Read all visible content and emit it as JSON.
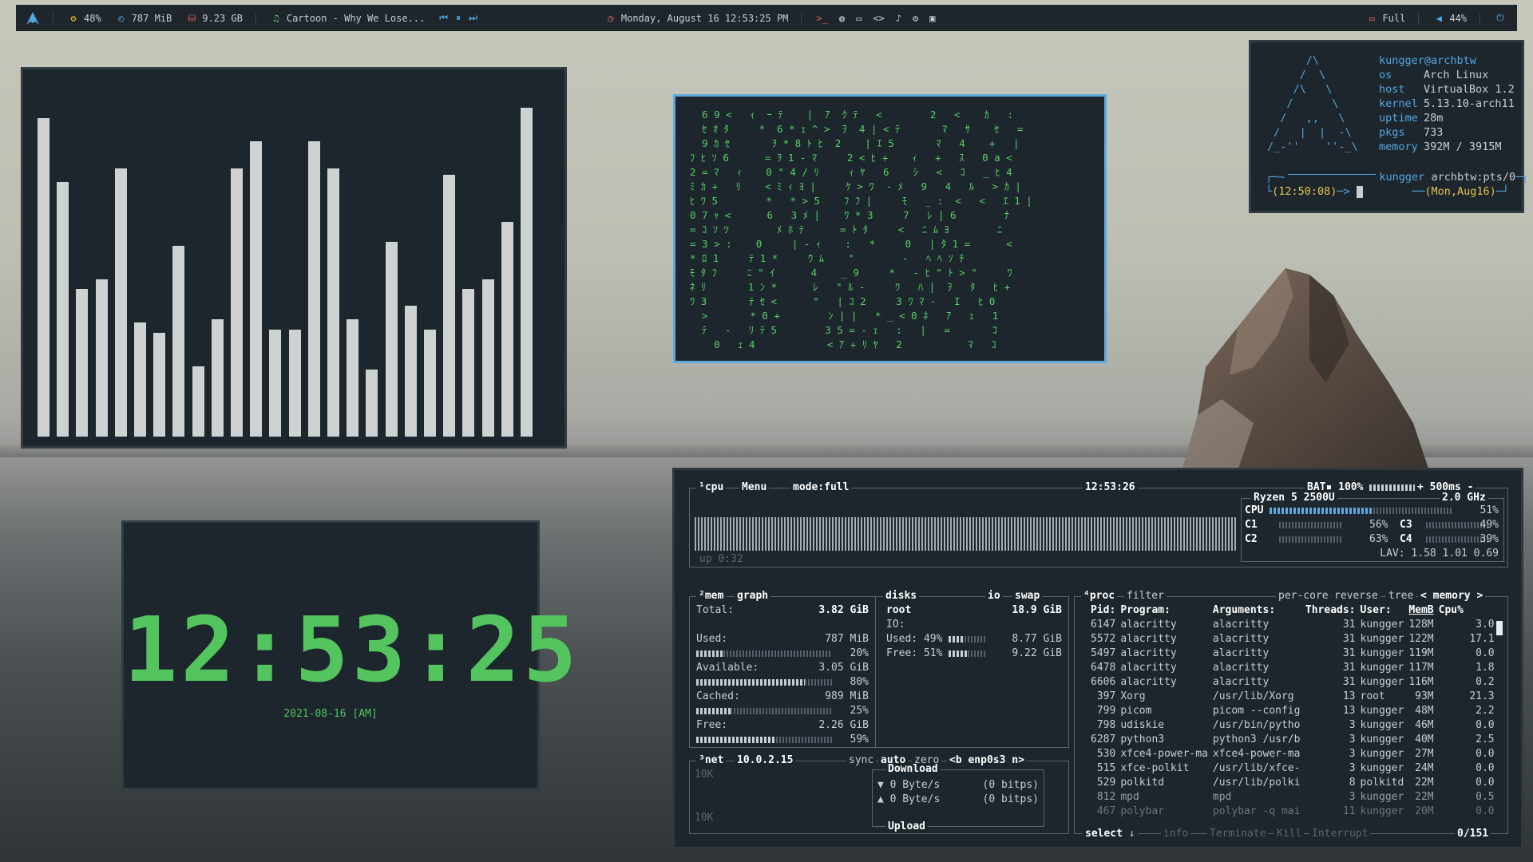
{
  "topbar": {
    "cpu": "48%",
    "ram": "787 MiB",
    "disk": "9.23 GB",
    "music": "Cartoon - Why We Lose...",
    "datetime": "Monday, August 16 12:53:25 PM",
    "battery": "Full",
    "volume": "44%"
  },
  "visualizer": {
    "levels": [
      0.95,
      0.76,
      0.44,
      0.47,
      0.8,
      0.34,
      0.31,
      0.57,
      0.21,
      0.35,
      0.8,
      0.88,
      0.32,
      0.32,
      0.88,
      0.8,
      0.35,
      0.2,
      0.58,
      0.39,
      0.32,
      0.78,
      0.44,
      0.47,
      0.64,
      0.98
    ]
  },
  "matrix": {
    "lines": [
      "  6 9 <   ｨ  ｰ ﾃ    |  ｱ  ｸ ﾃ   <        2   <    ｶ   :",
      "  ｾ ｵ ﾀ     *  6 * ｪ ^ >  ｦ  4 | < ﾃ       ﾏ   ｻ    ｾ   =",
      "  9 ｶ ｾ       ｦ * 8 ﾄ ﾋ  2    | ｴ 5       ﾏ   4    +   |",
      "ﾌ ﾋ ｿ 6      = ｦ 1 - ﾏ     2 < ﾋ +    ｨ   +   ｽ   0 a <",
      "2 = ﾏ   ｨ    0 \" 4 / ﾘ     ｨ ﾔ   6    ｼ   <   ｺ   _ ﾋ 4",
      "ﾐ ｶ +   ﾘ    < ﾐ ｨ ﾖ |     ｹ > ﾜ  - ﾒ   9   4   ﾙ   > ｶ |",
      "ﾋ ﾜ 5        *   * > 5    ﾌ ﾌ |     ﾓ   _ :  <   <   ｴ 1 |",
      "0 7 ｬ <      6   3 ﾒ |    ﾜ * 3     7   ﾚ | 6        ﾅ",
      "= ｺ ｿ ﾂ        ﾒ ﾎ ﾃ      = ﾄ ﾀ     <   ﾆ ﾑ ﾖ        ﾆ",
      "= 3 > :    0     | - ｨ    :   *     0   | ﾀ 1 =      <",
      "* ﾛ 1     ﾃ 1 *     ｳ ﾑ    \"        -   ﾍ ﾍ ｿ ﾁ",
      "ﾓ ﾀ ﾌ     ﾆ \" ｲ      4    _ 9     *   - ﾋ \" ﾄ > \"     ﾜ",
      "ﾈ ﾘ       1 ﾝ *      ﾚ   \" ﾙ -     ﾜ   ﾊ |  ｦ   ﾀ   ﾋ +",
      "ﾜ 3       ﾃ ｾ <      \"   | ｺ 2     3 ﾜ ﾏ -   I   ﾋ 0",
      "  >       * 0 +        ﾝ | |   * _ < 0 ﾈ   ｱ   ｪ   1",
      "  ﾃ   -   ﾘ ﾃ 5        3 5 = - ｪ   :   |   =       ｺ",
      "    0   ｪ 4            < ｱ + ﾘ ﾔ   2           ﾏ   ｺ"
    ]
  },
  "clock": {
    "time": "12:53:25",
    "date": "2021-08-16 [AM]"
  },
  "fetch": {
    "userhost": "kungger@archbtw",
    "rows": [
      {
        "k": "os",
        "v": "Arch Linux"
      },
      {
        "k": "host",
        "v": "VirtualBox 1.2"
      },
      {
        "k": "kernel",
        "v": "5.13.10-arch11"
      },
      {
        "k": "uptime",
        "v": "28m"
      },
      {
        "k": "pkgs",
        "v": "733"
      },
      {
        "k": "memory",
        "v": "392M / 3915M"
      }
    ],
    "logo": "      /\\\n     /  \\\n    /\\   \\\n   /      \\\n  /   ,,   \\\n /   |  |  -\\\n/_-''    ''-_\\",
    "prompt_user": "kungger",
    "prompt_host": "archbtw:pts/0",
    "prompt_time": "(12:50:08)",
    "prompt_date": "(Mon,Aug16)"
  },
  "btop": {
    "cpu_title": "¹cpu",
    "menu": "Menu",
    "mode": "mode:full",
    "time": "12:53:26",
    "bat": "BAT▪ 100%",
    "refresh": "+ 500ms -",
    "uptime": "up 0:32",
    "cpu_name": "Ryzen 5 2500U",
    "cpu_freq": "2.0 GHz",
    "cpu_total_label": "CPU",
    "cpu_total": "51%",
    "cores": [
      {
        "name": "C1",
        "val": "56%"
      },
      {
        "name": "C3",
        "val": "49%"
      },
      {
        "name": "C2",
        "val": "63%"
      },
      {
        "name": "C4",
        "val": "39%"
      }
    ],
    "lav": "LAV: 1.58 1.01 0.69",
    "mem_title": "²mem",
    "mem_graph": "graph",
    "mem": [
      {
        "label": "Total:",
        "val": "3.82 GiB",
        "pct": ""
      },
      {
        "label": "Used:",
        "val": "787 MiB",
        "pct": "20%"
      },
      {
        "label": "Available:",
        "val": "3.05 GiB",
        "pct": "80%"
      },
      {
        "label": "Cached:",
        "val": "989 MiB",
        "pct": "25%"
      },
      {
        "label": "Free:",
        "val": "2.26 GiB",
        "pct": "59%"
      }
    ],
    "disks_title": "disks",
    "io": "io",
    "swap": "swap",
    "disk_root": "root",
    "disk_size": "18.9 GiB",
    "disk_io": "IO:",
    "disk_used": "Used: 49%",
    "disk_used_val": "8.77 GiB",
    "disk_free": "Free: 51%",
    "disk_free_val": "9.22 GiB",
    "net_title": "³net",
    "net_ip": "10.0.2.15",
    "net_sync": "sync",
    "net_auto": "auto",
    "net_zero": "zero",
    "net_iface": "<b enp0s3 n>",
    "net_scale_top": "10K",
    "net_scale_bottom": "10K",
    "download": "Download",
    "upload": "Upload",
    "dl_rate": "▼ 0 Byte/s",
    "dl_bits": "(0 bitps)",
    "ul_rate": "▲ 0 Byte/s",
    "ul_bits": "(0 bitps)",
    "proc_title": "⁴proc",
    "filter": "filter",
    "per_core": "per-core",
    "reverse": "reverse",
    "tree": "tree",
    "sort": "< memory >",
    "headers": [
      "Pid:",
      "Program:",
      "Arguments:",
      "Threads:",
      "User:",
      "MemB",
      "Cpu%"
    ],
    "procs": [
      [
        "6147",
        "alacritty",
        "alacritty",
        "31",
        "kungger",
        "128M",
        "3.0"
      ],
      [
        "5572",
        "alacritty",
        "alacritty",
        "31",
        "kungger",
        "122M",
        "17.1"
      ],
      [
        "5497",
        "alacritty",
        "alacritty",
        "31",
        "kungger",
        "119M",
        "0.0"
      ],
      [
        "6478",
        "alacritty",
        "alacritty",
        "31",
        "kungger",
        "117M",
        "1.8"
      ],
      [
        "6606",
        "alacritty",
        "alacritty",
        "31",
        "kungger",
        "116M",
        "0.2"
      ],
      [
        "397",
        "Xorg",
        "/usr/lib/Xorg",
        "13",
        "root",
        "93M",
        "21.3"
      ],
      [
        "799",
        "picom",
        "picom --config",
        "13",
        "kungger",
        "48M",
        "2.2"
      ],
      [
        "798",
        "udiskie",
        "/usr/bin/pytho",
        "3",
        "kungger",
        "46M",
        "0.0"
      ],
      [
        "6287",
        "python3",
        "python3 /usr/b",
        "3",
        "kungger",
        "40M",
        "2.5"
      ],
      [
        "530",
        "xfce4-power-ma",
        "xfce4-power-ma",
        "3",
        "kungger",
        "27M",
        "0.0"
      ],
      [
        "515",
        "xfce-polkit",
        "/usr/lib/xfce-",
        "3",
        "kungger",
        "24M",
        "0.0"
      ],
      [
        "529",
        "polkitd",
        "/usr/lib/polki",
        "8",
        "polkitd",
        "22M",
        "0.0"
      ],
      [
        "812",
        "mpd",
        "mpd",
        "3",
        "kungger",
        "22M",
        "0.5"
      ],
      [
        "467",
        "polybar",
        "polybar -q mai",
        "11",
        "kungger",
        "20M",
        "0.0"
      ]
    ],
    "footer_select": "select",
    "footer_info": "info",
    "footer_terminate": "Terminate",
    "footer_kill": "Kill",
    "footer_interrupt": "Interrupt",
    "footer_count": "0/151"
  }
}
